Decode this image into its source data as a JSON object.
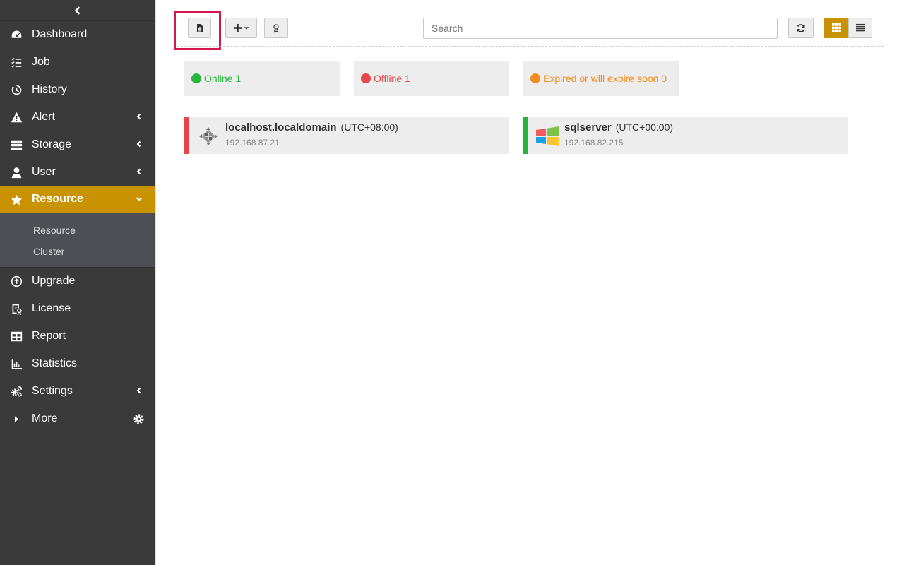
{
  "sidebar": {
    "items": [
      {
        "label": "Dashboard",
        "icon": "dashboard-icon"
      },
      {
        "label": "Job",
        "icon": "tasks-icon"
      },
      {
        "label": "History",
        "icon": "history-icon"
      },
      {
        "label": "Alert",
        "icon": "warning-icon"
      },
      {
        "label": "Storage",
        "icon": "storage-icon"
      },
      {
        "label": "User",
        "icon": "user-icon"
      },
      {
        "label": "Resource",
        "icon": "star-icon"
      },
      {
        "label": "Upgrade",
        "icon": "upgrade-icon"
      },
      {
        "label": "License",
        "icon": "license-icon"
      },
      {
        "label": "Report",
        "icon": "table-icon"
      },
      {
        "label": "Statistics",
        "icon": "chart-icon"
      },
      {
        "label": "Settings",
        "icon": "cogs-icon"
      },
      {
        "label": "More",
        "icon": "caret-right-icon"
      }
    ],
    "submenu": [
      "Resource",
      "Cluster"
    ],
    "accent_color": "#c99200"
  },
  "toolbar": {
    "search_placeholder": "Search"
  },
  "status": {
    "online": "Online 1",
    "offline": "Offline 1",
    "expired": "Expired or will expire soon 0",
    "colors": {
      "online": "#28b43c",
      "offline": "#e5474b",
      "expired": "#f28c1e"
    }
  },
  "resources": [
    {
      "name": "localhost.localdomain",
      "tz": "(UTC+08:00)",
      "ip": "192.168.87.21",
      "status": "offline",
      "os": "centos-icon"
    },
    {
      "name": "sqlserver",
      "tz": "(UTC+00:00)",
      "ip": "192.168.82.215",
      "status": "online",
      "os": "windows-icon"
    }
  ]
}
